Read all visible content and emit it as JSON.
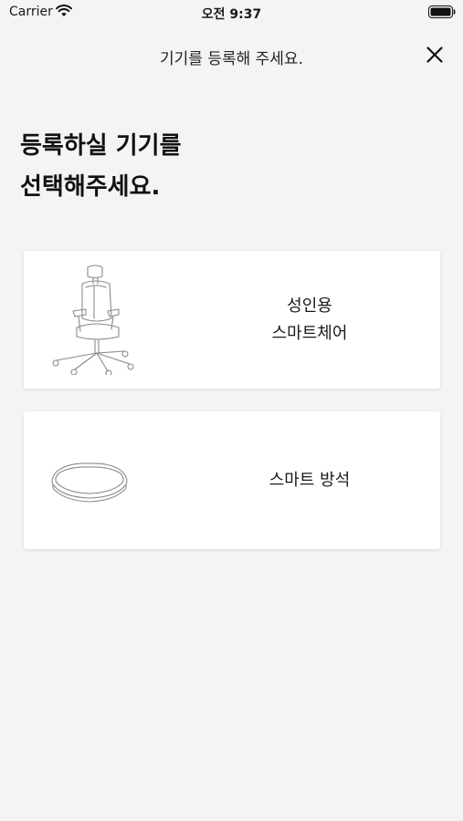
{
  "status_bar": {
    "carrier": "Carrier",
    "time": "오전 9:37",
    "icons": [
      "wifi-icon",
      "battery-icon"
    ]
  },
  "nav": {
    "title": "기기를 등록해 주세요.",
    "close_icon": "close-icon"
  },
  "heading": {
    "line1": "등록하실 기기를",
    "line2": "선택해주세요."
  },
  "devices": [
    {
      "icon": "office-chair-icon",
      "label_line1": "성인용",
      "label_line2": "스마트체어"
    },
    {
      "icon": "seat-cushion-icon",
      "label_line1": "스마트 방석"
    }
  ],
  "colors": {
    "background": "#f3f4f6",
    "card": "#ffffff",
    "text": "#1a1a1a"
  }
}
